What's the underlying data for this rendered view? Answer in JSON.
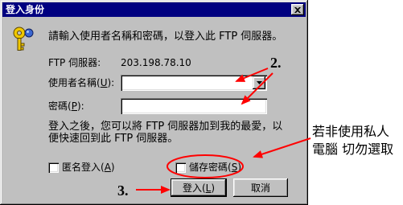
{
  "dialog": {
    "title": "登入身份",
    "instruction": "請輸入使用者名稱和密碼，以登入此 FTP 伺服器。",
    "server": {
      "label": "FTP 伺服器:",
      "value": "203.198.78.10"
    },
    "username": {
      "label": "使用者名稱(U):",
      "value": ""
    },
    "password": {
      "label": "密碼(P):",
      "value": ""
    },
    "info": [
      "登入之後，您可以將 FTP 伺服器加到我的最愛，以",
      "便快速回到此 FTP 伺服器。"
    ],
    "anonymous": {
      "label": "匿名登入(A)",
      "checked": false
    },
    "save_password": {
      "label": "儲存密碼(S)",
      "checked": false
    },
    "buttons": {
      "login": "登入(L)",
      "cancel": "取消"
    }
  },
  "annotations": {
    "step2": "2.",
    "step3": "3.",
    "note": [
      "若非使用私人",
      "電腦 切勿選取"
    ]
  },
  "icons": {
    "dialog": "key-icon",
    "close": "close-icon",
    "dropdown": "chevron-down-icon"
  },
  "colors": {
    "title_bar": "#000080",
    "title_text": "#ffffff",
    "dialog_bg": "#c0c0c0",
    "annotation": "#ff0000"
  }
}
